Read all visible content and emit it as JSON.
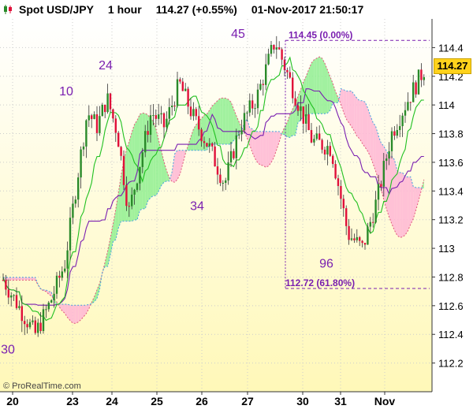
{
  "header": {
    "title": "Spot USD/JPY",
    "timeframe": "1 hour",
    "quote": "114.27 (+0.55%)",
    "datetime": "01-Nov-2017 21:50:17"
  },
  "watermark": "© ProRealTime.com",
  "last_price_tag": "114.27",
  "colors": {
    "bull_candle": "#2a8a2a",
    "bear_candle": "#e0103a",
    "candle_wick": "#333333",
    "tenkan": "#20c020",
    "kijun": "#7a1fb0",
    "cloud_bull": "#90ee90",
    "cloud_bear": "#ffb6d5",
    "wave_label": "#7a1fb0",
    "fib_line": "#7a1fb0",
    "price_tag": "#ffd21c"
  },
  "chart_data": {
    "type": "candlestick",
    "title": "Spot USD/JPY",
    "ylim": [
      112.0,
      114.6
    ],
    "y_ticks": [
      "114.4",
      "114.2",
      "114",
      "113.8",
      "113.6",
      "113.4",
      "113.2",
      "113",
      "112.8",
      "112.6",
      "112.4",
      "112.2"
    ],
    "x_ticks": [
      "20",
      "23",
      "24",
      "25",
      "26",
      "27",
      "30",
      "31",
      "Nov"
    ],
    "grid": true,
    "last_price": 114.27,
    "price_path": [
      [
        "20",
        112.78
      ],
      [
        "20",
        112.4
      ],
      [
        "20",
        112.62
      ],
      [
        "20",
        112.9
      ],
      [
        "23",
        113.5
      ],
      [
        "23",
        113.95
      ],
      [
        "23",
        113.85
      ],
      [
        "23",
        114.05
      ],
      [
        "24",
        113.8
      ],
      [
        "24",
        113.25
      ],
      [
        "24",
        113.6
      ],
      [
        "24",
        113.95
      ],
      [
        "25",
        113.85
      ],
      [
        "25",
        114.15
      ],
      [
        "25",
        113.9
      ],
      [
        "26",
        113.7
      ],
      [
        "26",
        113.45
      ],
      [
        "26",
        113.85
      ],
      [
        "27",
        114.05
      ],
      [
        "27",
        114.45
      ],
      [
        "27",
        114.1
      ],
      [
        "30",
        113.75
      ],
      [
        "30",
        113.7
      ],
      [
        "31",
        113.1
      ],
      [
        "31",
        113.0
      ],
      [
        "31",
        113.35
      ],
      [
        "Nov",
        113.8
      ],
      [
        "Nov",
        114.0
      ],
      [
        "Nov",
        114.27
      ]
    ],
    "wave_labels": [
      {
        "text": "30",
        "x": "20",
        "y": 112.3
      },
      {
        "text": "10",
        "x": "23",
        "y": 114.1
      },
      {
        "text": "24",
        "x": "24",
        "y": 114.28
      },
      {
        "text": "34",
        "x": "26",
        "y": 113.3
      },
      {
        "text": "45",
        "x": "27",
        "y": 114.5
      },
      {
        "text": "96",
        "x": "31",
        "y": 112.9
      }
    ],
    "fib_levels": [
      {
        "label": "114.45 (0.00%)",
        "value": 114.45
      },
      {
        "label": "112.72 (61.80%)",
        "value": 112.72
      }
    ]
  }
}
